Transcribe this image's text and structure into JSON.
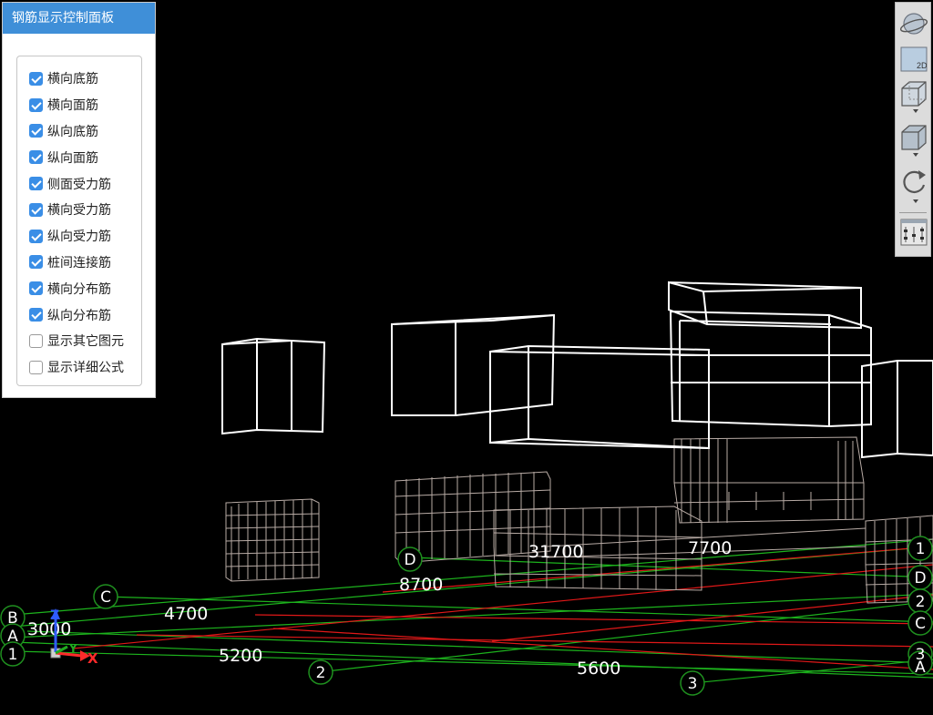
{
  "panel": {
    "title": "钢筋显示控制面板",
    "options": [
      {
        "label": "横向底筋",
        "checked": true
      },
      {
        "label": "横向面筋",
        "checked": true
      },
      {
        "label": "纵向底筋",
        "checked": true
      },
      {
        "label": "纵向面筋",
        "checked": true
      },
      {
        "label": "侧面受力筋",
        "checked": true
      },
      {
        "label": "横向受力筋",
        "checked": true
      },
      {
        "label": "纵向受力筋",
        "checked": true
      },
      {
        "label": "桩间连接筋",
        "checked": true
      },
      {
        "label": "横向分布筋",
        "checked": true
      },
      {
        "label": "纵向分布筋",
        "checked": true
      },
      {
        "label": "显示其它图元",
        "checked": false
      },
      {
        "label": "显示详细公式",
        "checked": false
      }
    ]
  },
  "toolbar": {
    "view2d_label": "2D",
    "tools": [
      "orbit-icon",
      "view-2d-icon",
      "cube-transparent-icon",
      "cube-solid-icon",
      "rotate-icon",
      "settings-panel-icon"
    ]
  },
  "viewport": {
    "axis_labels": {
      "z": "Z",
      "y": "Y",
      "x": "X"
    },
    "grid_labels": {
      "c_top": "C",
      "d_mid": "D",
      "b_left": "B",
      "a_left": "A",
      "one_left": "1",
      "two_bottom": "2",
      "three_bottom": "3",
      "right_1": "1",
      "right_d": "D",
      "right_2": "2",
      "right_c": "C",
      "right_3": "3",
      "right_a": "A"
    },
    "dimensions": {
      "d1": "3000",
      "d2": "4700",
      "d3": "5200",
      "d4": "8700",
      "d5": "5600",
      "d6": "31700",
      "d7": "7700"
    },
    "colors": {
      "grid_green": "#1db31d",
      "grid_red": "#e01818",
      "bubble": "#1f8f1f",
      "frame": "#ffffff",
      "rebar": "#b8aba5",
      "axis_z": "#2f5cff",
      "axis_y": "#1faa1f",
      "axis_x": "#ff2a2a"
    }
  }
}
